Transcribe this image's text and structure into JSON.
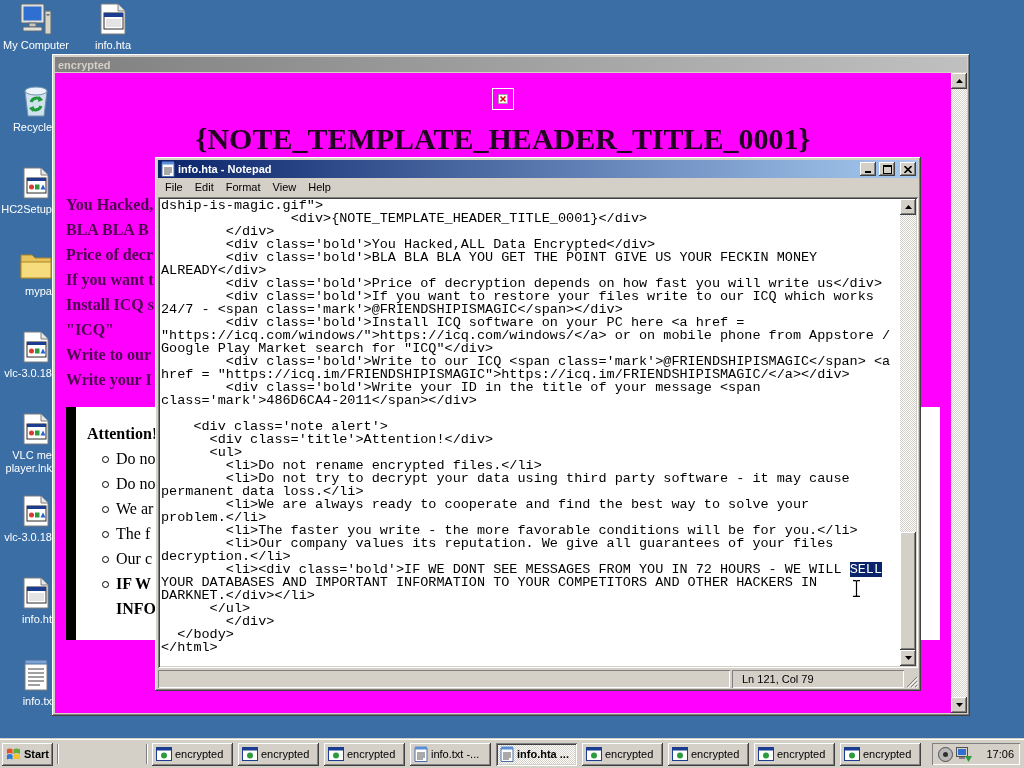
{
  "desktop": {
    "icons": [
      {
        "kind": "computer",
        "label_lines": [
          "My Computer"
        ]
      },
      {
        "kind": "recycle-bin",
        "label_lines": [
          "Recycle"
        ]
      },
      {
        "kind": "program",
        "label_lines": [
          "HC2Setup"
        ]
      },
      {
        "kind": "folder",
        "label_lines": [
          "mypa"
        ]
      },
      {
        "kind": "program",
        "label_lines": [
          "vlc-3.0.18"
        ]
      },
      {
        "kind": "program",
        "label_lines": [
          "VLC me",
          "player.lnk"
        ]
      },
      {
        "kind": "program",
        "label_lines": [
          "vlc-3.0.18"
        ]
      },
      {
        "kind": "hta",
        "label_lines": [
          "info.ht"
        ]
      },
      {
        "kind": "text-file",
        "label_lines": [
          "info.tx"
        ]
      },
      {
        "kind": "hta",
        "label_lines": [
          "info.hta"
        ]
      }
    ]
  },
  "hta_window": {
    "title": "encrypted",
    "active": false,
    "header": "{NOTE_TEMPLATE_HEADER_TITLE_0001}",
    "lines": [
      "You Hacked,",
      "BLA BLA B",
      "Price of decr",
      "If you want t",
      "Install ICQ s",
      "\"ICQ\"",
      "Write to our",
      "Write your I"
    ],
    "alert": {
      "title": "Attention!",
      "items": [
        {
          "lines": [
            "Do no"
          ],
          "bold": false
        },
        {
          "lines": [
            "Do no"
          ],
          "bold": false
        },
        {
          "lines": [
            "We ar"
          ],
          "bold": false
        },
        {
          "lines": [
            "The f"
          ],
          "bold": false
        },
        {
          "lines": [
            "Our c"
          ],
          "bold": false
        },
        {
          "lines": [
            "IF W",
            "INFO"
          ],
          "bold": true
        }
      ]
    }
  },
  "notepad": {
    "title": "info.hta - Notepad",
    "active": true,
    "menu": [
      "File",
      "Edit",
      "Format",
      "View",
      "Help"
    ],
    "blocks": [
      [
        {
          "text": "dship-is-magic.gif\">"
        },
        {
          "text": "                <div>{NOTE_TEMPLATE_HEADER_TITLE_0001}</div>"
        },
        {
          "text": "        </div>"
        },
        {
          "text": "        <div class='bold'>You Hacked,ALL Data Encrypted</div>"
        },
        {
          "text": "        <div class='bold'>BLA BLA BLA YOU GET THE POINT GIVE US YOUR FECKIN MONEY"
        },
        {
          "text": "ALREADY</div>"
        },
        {
          "text": "        <div class='bold'>Price of decryption depends on how fast you will write us</div>"
        },
        {
          "text": "        <div class='bold'>If you want to restore your files write to our ICQ which works"
        },
        {
          "text": "24/7 - <span class='mark'>@FRIENDSHIPISMAGIC</span></div>"
        },
        {
          "text": "        <div class='bold'>Install ICQ software on your PC here <a href ="
        },
        {
          "text": "\"https://icq.com/windows/\">https://icq.com/windows/</a> or on mobile phone from Appstore /"
        },
        {
          "text": "Google Play Market search for \"ICQ\"</div>"
        },
        {
          "text": "        <div class='bold'>Write to our ICQ <span class='mark'>@FRIENDSHIPISMAGIC</span> <a"
        },
        {
          "text": "href = \"https://icq.im/FRIENDSHIPISMAGIC\">https://icq.im/FRIENDSHIPISMAGIC/</a></div>"
        },
        {
          "text": "        <div class='bold'>Write your ID in the title of your message <span"
        },
        {
          "text": "class='mark'>486D6CA4-2011</span></div>"
        }
      ],
      [
        {
          "text": "    <div class='note alert'>"
        },
        {
          "text": "      <div class='title'>Attention!</div>"
        },
        {
          "text": "      <ul>"
        },
        {
          "text": "        <li>Do not rename encrypted files.</li>"
        },
        {
          "text": "        <li>Do not try to decrypt your data using third party software - it may cause"
        },
        {
          "text": "permanent data loss.</li>"
        },
        {
          "text": "        <li>We are always ready to cooperate and find the best way to solve your"
        },
        {
          "text": "problem.</li>"
        },
        {
          "text": "        <li>The faster you write - the more favorable conditions will be for you.</li>"
        },
        {
          "text": "        <li>Our company values its reputation. We give all guarantees of your files"
        },
        {
          "text": "decryption.</li>"
        },
        {
          "text": "        <li><div class='bold'>IF WE DONT SEE MESSAGES FROM YOU IN 72 HOURS - WE WILL ",
          "selected_text": "SELL"
        },
        {
          "text": "YOUR DATABASES AND IMPORTANT INFORMATION TO YOUR COMPETITORS AND OTHER HACKERS IN"
        },
        {
          "text": "DARKNET.</div></li>"
        },
        {
          "text": "      </ul>"
        },
        {
          "text": "        </div>"
        },
        {
          "text": "  </body>"
        },
        {
          "text": "</html>"
        }
      ]
    ],
    "status": "Ln 121, Col 79"
  },
  "taskbar": {
    "start": "Start",
    "tasks": [
      {
        "kind": "hta",
        "label": "encrypted",
        "selected": false
      },
      {
        "kind": "hta",
        "label": "encrypted",
        "selected": false
      },
      {
        "kind": "hta",
        "label": "encrypted",
        "selected": false
      },
      {
        "kind": "notepad",
        "label": "info.txt -...",
        "selected": false
      },
      {
        "kind": "notepad",
        "label": "info.hta ...",
        "selected": true
      },
      {
        "kind": "hta",
        "label": "encrypted",
        "selected": false
      },
      {
        "kind": "hta",
        "label": "encrypted",
        "selected": false
      },
      {
        "kind": "hta",
        "label": "encrypted",
        "selected": false
      },
      {
        "kind": "hta",
        "label": "encrypted",
        "selected": false
      }
    ],
    "clock": "17:06"
  }
}
